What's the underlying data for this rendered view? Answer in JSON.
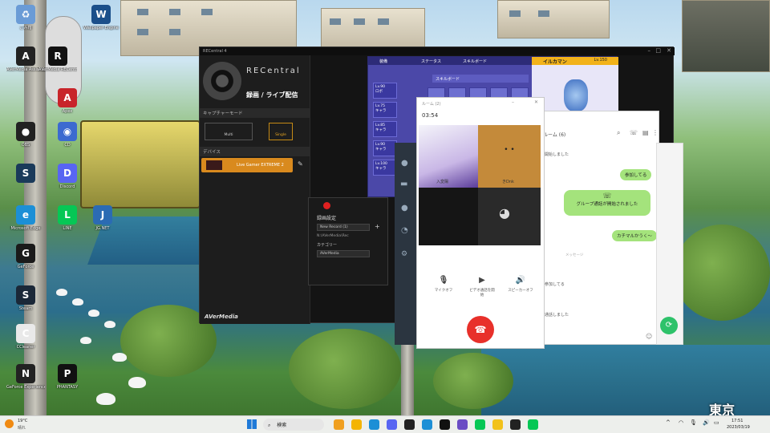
{
  "desktop": {
    "icons": [
      {
        "name": "recycle-bin",
        "label": "ごみ箱",
        "color": "#6a9bd6",
        "glyph": "♻"
      },
      {
        "name": "wallpaper-engine",
        "label": "Wallpaper Engine",
        "color": "#1b4f8a",
        "glyph": "W"
      },
      {
        "name": "avermedia-assist",
        "label": "AVerMedia Assist Central",
        "color": "#222",
        "glyph": "A"
      },
      {
        "name": "avermedia-recentral",
        "label": "AVerMedia RECentral",
        "color": "#111",
        "glyph": "R"
      },
      {
        "name": "apex",
        "label": "Apex",
        "color": "#c8242a",
        "glyph": "A"
      },
      {
        "name": "obs",
        "label": "OBS",
        "color": "#222",
        "glyph": "●"
      },
      {
        "name": "cd",
        "label": "CD",
        "color": "#3c6ad0",
        "glyph": "◉"
      },
      {
        "name": "steam-link",
        "label": "",
        "color": "#1a3a5a",
        "glyph": "S"
      },
      {
        "name": "discord",
        "label": "Discord",
        "color": "#5865f2",
        "glyph": "D"
      },
      {
        "name": "edge",
        "label": "Microsoft Edge",
        "color": "#1c8fd6",
        "glyph": "e"
      },
      {
        "name": "line",
        "label": "LINE",
        "color": "#06c755",
        "glyph": "L"
      },
      {
        "name": "jgnet",
        "label": "JG.NET",
        "color": "#2b6bb3",
        "glyph": "J"
      },
      {
        "name": "geforce",
        "label": "GeForce",
        "color": "#1a1a1a",
        "glyph": "G"
      },
      {
        "name": "steam",
        "label": "Steam",
        "color": "#1b2838",
        "glyph": "S"
      },
      {
        "name": "ccleaner",
        "label": "CCleaner",
        "color": "#e9e9e9",
        "glyph": "C"
      },
      {
        "name": "nvidia",
        "label": "GeForce Experience",
        "color": "#222",
        "glyph": "N"
      },
      {
        "name": "pixel",
        "label": "PHANTASY",
        "color": "#111",
        "glyph": "P"
      }
    ]
  },
  "recentral": {
    "title": "RECentral 4",
    "brand": "RECentral",
    "mode_title": "録画 / ライブ配信",
    "capture_mode": "キャプチャーモード",
    "mode_multi": "Multi",
    "mode_single": "Single",
    "device_label": "デバイス",
    "device_name": "Live Gamer EXTREME 2",
    "footer_brand": "AVerMedia",
    "panel_title": "録画設定",
    "panel_file": "New Record (1)",
    "panel_path": "N:\\AVerMedia\\Rec",
    "panel_category": "カテゴリー",
    "panel_cat_value": "AVerMedia"
  },
  "game": {
    "tabs": [
      "装備",
      "ステータス",
      "スキルボード"
    ],
    "right_title": "イルカマン",
    "right_level": "Lv.150",
    "levels": [
      "Lv.90",
      "Lv.75",
      "Lv.85",
      "Lv.90",
      "Lv.100"
    ],
    "names": [
      "ロボ",
      "キャラ",
      "キャラ",
      "キャラ",
      "キャラ"
    ],
    "sub": "スキルボード"
  },
  "call": {
    "title": "ルーム (2)",
    "timer": "03:54",
    "p1": "入変陽",
    "p2": "きDnk",
    "ctrl_mic": "マイクオフ",
    "ctrl_cam": "ビデオ通話を開始",
    "ctrl_spk": "スピーカーオフ"
  },
  "chat": {
    "title": "ルーム (6)",
    "msg1": "開始しました",
    "bubble1": "参加してる",
    "sys": "グループ通話が開始されました",
    "bubble2": "カチマルかうく〜",
    "note": "メッセージ",
    "msg2": "参加してる",
    "msg3": "通話しました"
  },
  "taskbar": {
    "weather_temp": "19°C",
    "weather_desc": "晴れ",
    "search": "検索",
    "time": "17:51",
    "date": "2023/03/19"
  },
  "watermark": "東京"
}
